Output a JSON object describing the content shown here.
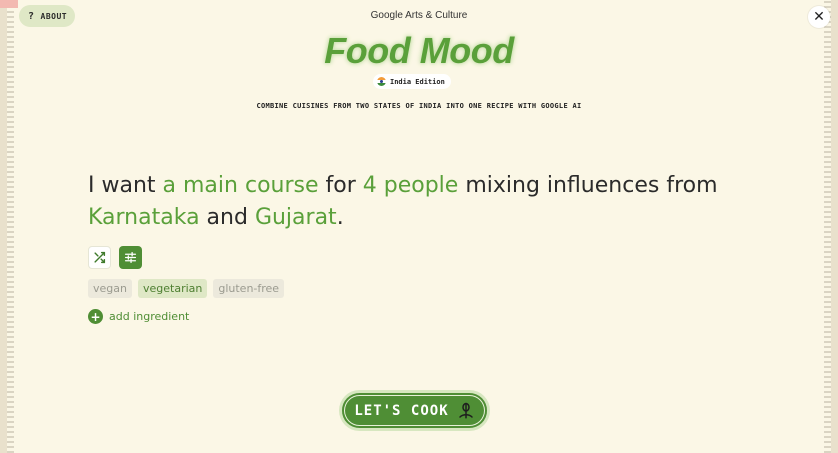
{
  "header": {
    "about_label": "ABOUT",
    "brand": "Google Arts & Culture",
    "title": "Food Mood",
    "edition": "India Edition",
    "tagline": "COMBINE CUISINES FROM TWO STATES OF INDIA INTO ONE RECIPE WITH GOOGLE AI"
  },
  "sentence": {
    "part1": "I want ",
    "course": "a main course",
    "part2": " for ",
    "people": "4 people",
    "part3": " mixing influences from ",
    "state1": "Karnataka",
    "part4": " and ",
    "state2": "Gujarat",
    "part5": "."
  },
  "tags": [
    "vegan",
    "vegetarian",
    "gluten-free"
  ],
  "add_ingredient_label": "add ingredient",
  "cook_label": "LET'S COOK",
  "colors": {
    "background": "#fbf7e6",
    "accent": "#5aa03a",
    "button": "#4f8e35",
    "tag_selected": "#dfe8c6"
  },
  "icons": {
    "about": "question-icon",
    "close": "close-icon",
    "flag": "india-flag-icon",
    "shuffle": "shuffle-icon",
    "tune": "sliders-icon",
    "add": "plus-icon",
    "cook": "whisk-icon"
  }
}
